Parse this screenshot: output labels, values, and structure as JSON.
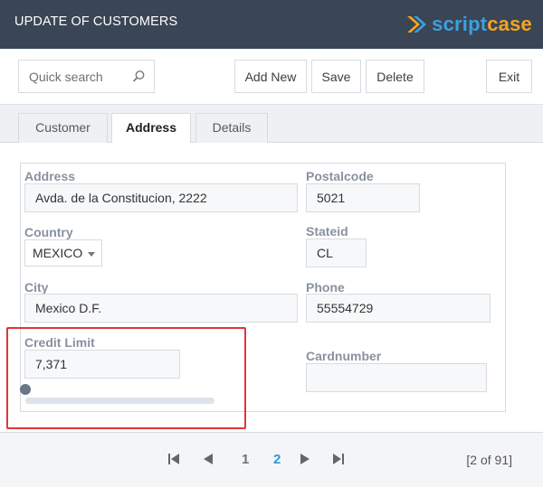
{
  "header": {
    "title": "UPDATE OF CUSTOMERS",
    "logo": {
      "part1": "script",
      "part2": "case",
      "colors": {
        "blue": "#3aa0e0",
        "orange": "#f4a521"
      }
    }
  },
  "toolbar": {
    "search_placeholder": "Quick search",
    "add_new_label": "Add New",
    "save_label": "Save",
    "delete_label": "Delete",
    "exit_label": "Exit"
  },
  "tabs": [
    {
      "label": "Customer",
      "active": false
    },
    {
      "label": "Address",
      "active": true
    },
    {
      "label": "Details",
      "active": false
    }
  ],
  "form": {
    "address": {
      "label": "Address",
      "value": "Avda. de la Constitucion, 2222"
    },
    "postalcode": {
      "label": "Postalcode",
      "value": "5021"
    },
    "country": {
      "label": "Country",
      "value": "MEXICO"
    },
    "stateid": {
      "label": "Stateid",
      "value": "CL"
    },
    "city": {
      "label": "City",
      "value": "Mexico D.F."
    },
    "phone": {
      "label": "Phone",
      "value": "55554729"
    },
    "credit_limit": {
      "label": "Credit Limit",
      "value": "7,371",
      "slider_fraction": 0.0
    },
    "cardnumber": {
      "label": "Cardnumber",
      "value": ""
    }
  },
  "pagination": {
    "pages": [
      "1",
      "2"
    ],
    "current": "2",
    "counter": "[2 of 91]"
  },
  "colors": {
    "header_bg": "#3a4555",
    "accent": "#2f9ad6",
    "highlight": "#e0353b"
  }
}
